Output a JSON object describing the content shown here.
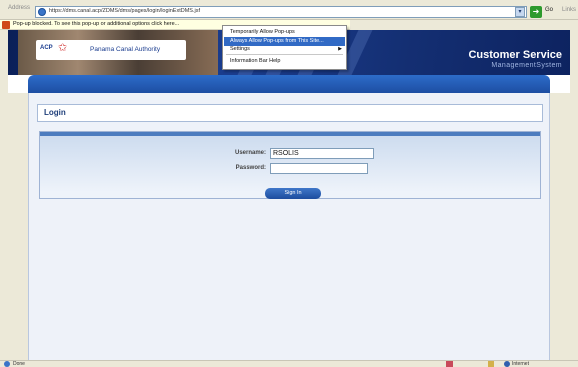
{
  "browser": {
    "address_label": "Address",
    "url": "https://dms.canal.acp/ZDMS/dms/pages/login/loginExtDMS.jsf",
    "go_label": "Go",
    "links_label": "Links",
    "infobar_text": "Pop-up blocked. To see this pop-up or additional options click here...",
    "status_text": "Done",
    "zone_text": "Internet"
  },
  "popup_menu": {
    "items": [
      {
        "label": "Temporarily Allow Pop-ups"
      },
      {
        "label": "Always Allow Pop-ups from This Site..."
      },
      {
        "label": "Settings",
        "arrow": "▶"
      },
      {
        "label": "Information Bar Help"
      }
    ]
  },
  "header": {
    "logo_acp": "ACP",
    "logo_name": "Panama Canal Authority",
    "brand_line1": "Customer Service",
    "brand_line2": "ManagementSystem"
  },
  "login": {
    "title": "Login",
    "username_label": "Username:",
    "username_value": "RSOLIS",
    "password_label": "Password:",
    "password_value": "",
    "signin_label": "Sign In"
  }
}
